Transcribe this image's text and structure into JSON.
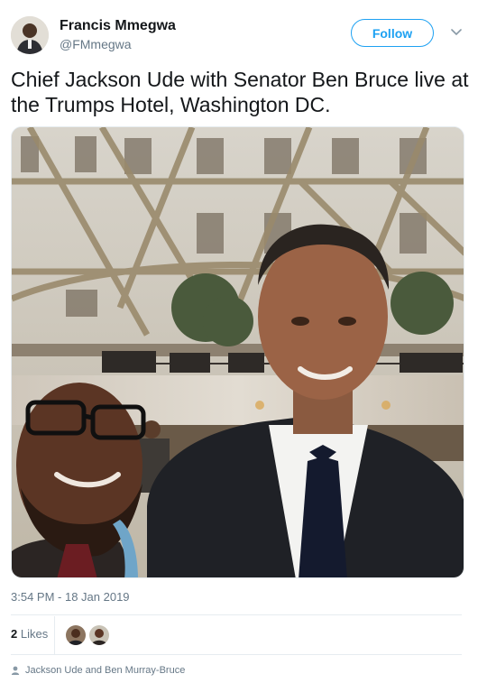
{
  "tweet": {
    "author": {
      "name": "Francis Mmegwa",
      "handle": "@FMmegwa"
    },
    "follow_label": "Follow",
    "text": "Chief Jackson Ude with Senator Ben Bruce live at the Trumps Hotel, Washington DC.",
    "timestamp": "3:54 PM - 18 Jan 2019",
    "likes": {
      "count": "2",
      "label": "Likes"
    },
    "tagged": "Jackson Ude and Ben Murray-Bruce"
  },
  "icons": {
    "caret": "chevron-down-icon",
    "tag": "person-icon"
  },
  "colors": {
    "accent": "#1da1f2",
    "secondary_text": "#657786",
    "divider": "#e6ecf0"
  }
}
